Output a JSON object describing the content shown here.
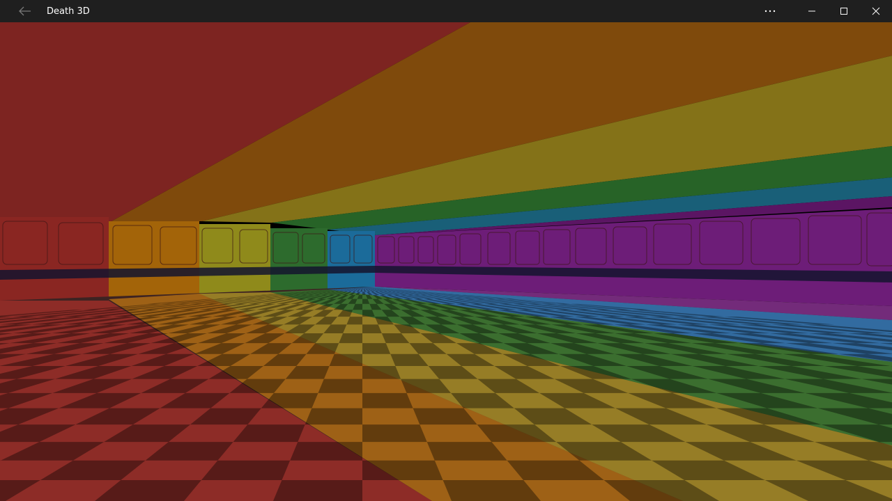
{
  "window": {
    "title": "Death 3D",
    "back_icon": "arrow-left-icon",
    "more_icon": "more-icon",
    "minimize_icon": "minimize-icon",
    "maximize_icon": "maximize-icon",
    "close_icon": "close-icon"
  },
  "scene": {
    "ceiling_bands": [
      "#7d2421",
      "#7f4a0c",
      "#847218",
      "#276327",
      "#195f78",
      "#5b1563"
    ],
    "wall_colors": [
      "#8a2622",
      "#a36409",
      "#8f8a1b",
      "#2d6b2d",
      "#1b6b9a",
      "#6d1d78"
    ],
    "floor_colors": [
      "#d0342c",
      "#e08a0f",
      "#e0c92a",
      "#3b8f35",
      "#2e8ad6",
      "#8a2fa0"
    ],
    "floor_dark": "#3d2322"
  }
}
